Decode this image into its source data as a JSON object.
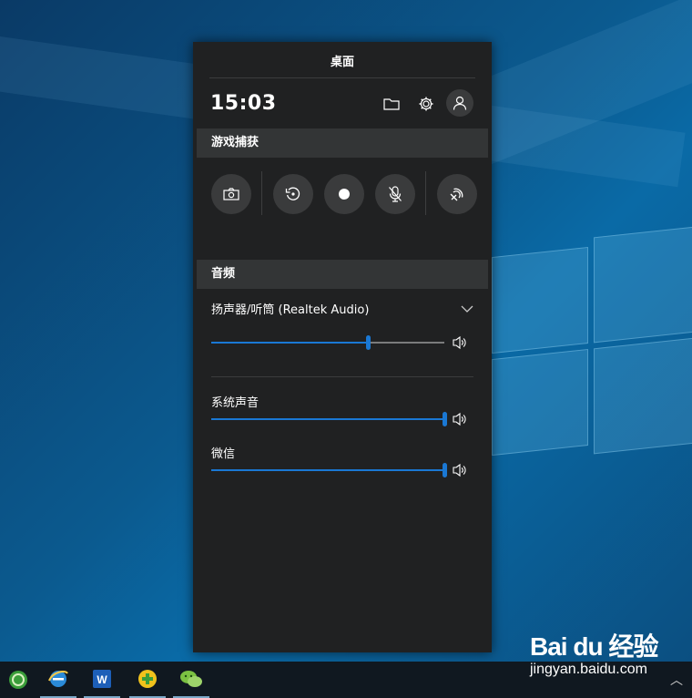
{
  "panel": {
    "title": "桌面",
    "clock": "15:03",
    "icons": [
      "folder-icon",
      "gear-icon",
      "user-icon"
    ]
  },
  "capture": {
    "section_title": "游戏捕获",
    "buttons": [
      "camera-icon",
      "replay-icon",
      "record-icon",
      "mic-off-icon",
      "broadcast-icon"
    ]
  },
  "audio": {
    "section_title": "音频",
    "device": {
      "label": "扬声器/听筒 (Realtek Audio)",
      "volume": 0.67
    },
    "apps": [
      {
        "label": "系统声音",
        "volume": 1.0
      },
      {
        "label": "微信",
        "volume": 1.0
      }
    ]
  },
  "taskbar": {
    "items": [
      "browser-360-icon",
      "ie-icon",
      "wps-icon",
      "security-360-icon",
      "wechat-icon"
    ]
  },
  "watermark": {
    "logo": "Bai du 经验",
    "url": "jingyan.baidu.com"
  },
  "colors": {
    "accent": "#1a78d4",
    "panel_bg": "#202122",
    "section_bg": "#333536"
  }
}
